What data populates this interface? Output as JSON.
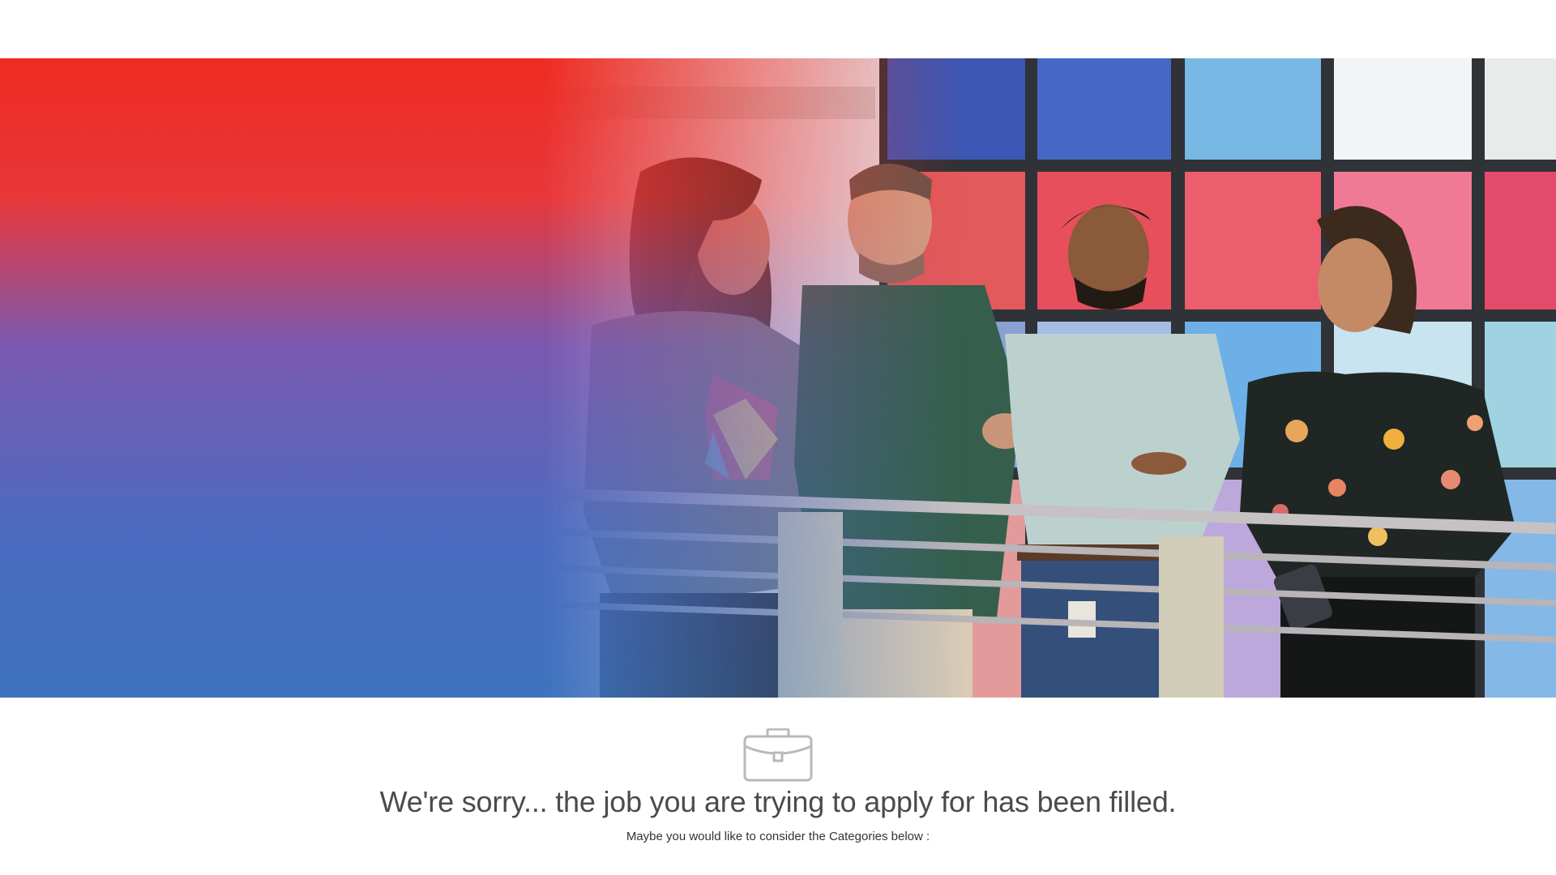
{
  "hero": {
    "image_description_icon": "team-photo",
    "gradient_colors": {
      "red": "#ee2b22",
      "purple": "#6a5bb4",
      "blue": "#3f6fba"
    }
  },
  "message": {
    "icon": "briefcase-icon",
    "headline": "We're sorry... the job you are trying to apply for has been filled.",
    "subline": "Maybe you would like to consider the Categories below :"
  }
}
